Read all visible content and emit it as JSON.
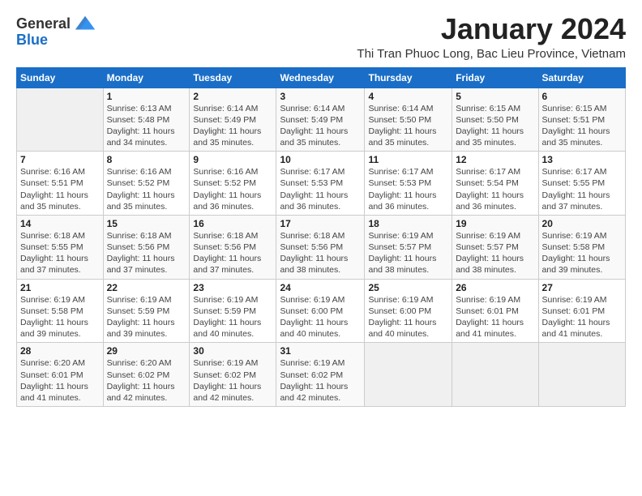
{
  "header": {
    "logo_line1": "General",
    "logo_line2": "Blue",
    "month_title": "January 2024",
    "subtitle": "Thi Tran Phuoc Long, Bac Lieu Province, Vietnam"
  },
  "days_of_week": [
    "Sunday",
    "Monday",
    "Tuesday",
    "Wednesday",
    "Thursday",
    "Friday",
    "Saturday"
  ],
  "weeks": [
    [
      {
        "num": "",
        "sunrise": "",
        "sunset": "",
        "daylight": "",
        "empty": true
      },
      {
        "num": "1",
        "sunrise": "Sunrise: 6:13 AM",
        "sunset": "Sunset: 5:48 PM",
        "daylight": "Daylight: 11 hours and 34 minutes."
      },
      {
        "num": "2",
        "sunrise": "Sunrise: 6:14 AM",
        "sunset": "Sunset: 5:49 PM",
        "daylight": "Daylight: 11 hours and 35 minutes."
      },
      {
        "num": "3",
        "sunrise": "Sunrise: 6:14 AM",
        "sunset": "Sunset: 5:49 PM",
        "daylight": "Daylight: 11 hours and 35 minutes."
      },
      {
        "num": "4",
        "sunrise": "Sunrise: 6:14 AM",
        "sunset": "Sunset: 5:50 PM",
        "daylight": "Daylight: 11 hours and 35 minutes."
      },
      {
        "num": "5",
        "sunrise": "Sunrise: 6:15 AM",
        "sunset": "Sunset: 5:50 PM",
        "daylight": "Daylight: 11 hours and 35 minutes."
      },
      {
        "num": "6",
        "sunrise": "Sunrise: 6:15 AM",
        "sunset": "Sunset: 5:51 PM",
        "daylight": "Daylight: 11 hours and 35 minutes."
      }
    ],
    [
      {
        "num": "7",
        "sunrise": "Sunrise: 6:16 AM",
        "sunset": "Sunset: 5:51 PM",
        "daylight": "Daylight: 11 hours and 35 minutes."
      },
      {
        "num": "8",
        "sunrise": "Sunrise: 6:16 AM",
        "sunset": "Sunset: 5:52 PM",
        "daylight": "Daylight: 11 hours and 35 minutes."
      },
      {
        "num": "9",
        "sunrise": "Sunrise: 6:16 AM",
        "sunset": "Sunset: 5:52 PM",
        "daylight": "Daylight: 11 hours and 36 minutes."
      },
      {
        "num": "10",
        "sunrise": "Sunrise: 6:17 AM",
        "sunset": "Sunset: 5:53 PM",
        "daylight": "Daylight: 11 hours and 36 minutes."
      },
      {
        "num": "11",
        "sunrise": "Sunrise: 6:17 AM",
        "sunset": "Sunset: 5:53 PM",
        "daylight": "Daylight: 11 hours and 36 minutes."
      },
      {
        "num": "12",
        "sunrise": "Sunrise: 6:17 AM",
        "sunset": "Sunset: 5:54 PM",
        "daylight": "Daylight: 11 hours and 36 minutes."
      },
      {
        "num": "13",
        "sunrise": "Sunrise: 6:17 AM",
        "sunset": "Sunset: 5:55 PM",
        "daylight": "Daylight: 11 hours and 37 minutes."
      }
    ],
    [
      {
        "num": "14",
        "sunrise": "Sunrise: 6:18 AM",
        "sunset": "Sunset: 5:55 PM",
        "daylight": "Daylight: 11 hours and 37 minutes."
      },
      {
        "num": "15",
        "sunrise": "Sunrise: 6:18 AM",
        "sunset": "Sunset: 5:56 PM",
        "daylight": "Daylight: 11 hours and 37 minutes."
      },
      {
        "num": "16",
        "sunrise": "Sunrise: 6:18 AM",
        "sunset": "Sunset: 5:56 PM",
        "daylight": "Daylight: 11 hours and 37 minutes."
      },
      {
        "num": "17",
        "sunrise": "Sunrise: 6:18 AM",
        "sunset": "Sunset: 5:56 PM",
        "daylight": "Daylight: 11 hours and 38 minutes."
      },
      {
        "num": "18",
        "sunrise": "Sunrise: 6:19 AM",
        "sunset": "Sunset: 5:57 PM",
        "daylight": "Daylight: 11 hours and 38 minutes."
      },
      {
        "num": "19",
        "sunrise": "Sunrise: 6:19 AM",
        "sunset": "Sunset: 5:57 PM",
        "daylight": "Daylight: 11 hours and 38 minutes."
      },
      {
        "num": "20",
        "sunrise": "Sunrise: 6:19 AM",
        "sunset": "Sunset: 5:58 PM",
        "daylight": "Daylight: 11 hours and 39 minutes."
      }
    ],
    [
      {
        "num": "21",
        "sunrise": "Sunrise: 6:19 AM",
        "sunset": "Sunset: 5:58 PM",
        "daylight": "Daylight: 11 hours and 39 minutes."
      },
      {
        "num": "22",
        "sunrise": "Sunrise: 6:19 AM",
        "sunset": "Sunset: 5:59 PM",
        "daylight": "Daylight: 11 hours and 39 minutes."
      },
      {
        "num": "23",
        "sunrise": "Sunrise: 6:19 AM",
        "sunset": "Sunset: 5:59 PM",
        "daylight": "Daylight: 11 hours and 40 minutes."
      },
      {
        "num": "24",
        "sunrise": "Sunrise: 6:19 AM",
        "sunset": "Sunset: 6:00 PM",
        "daylight": "Daylight: 11 hours and 40 minutes."
      },
      {
        "num": "25",
        "sunrise": "Sunrise: 6:19 AM",
        "sunset": "Sunset: 6:00 PM",
        "daylight": "Daylight: 11 hours and 40 minutes."
      },
      {
        "num": "26",
        "sunrise": "Sunrise: 6:19 AM",
        "sunset": "Sunset: 6:01 PM",
        "daylight": "Daylight: 11 hours and 41 minutes."
      },
      {
        "num": "27",
        "sunrise": "Sunrise: 6:19 AM",
        "sunset": "Sunset: 6:01 PM",
        "daylight": "Daylight: 11 hours and 41 minutes."
      }
    ],
    [
      {
        "num": "28",
        "sunrise": "Sunrise: 6:20 AM",
        "sunset": "Sunset: 6:01 PM",
        "daylight": "Daylight: 11 hours and 41 minutes."
      },
      {
        "num": "29",
        "sunrise": "Sunrise: 6:20 AM",
        "sunset": "Sunset: 6:02 PM",
        "daylight": "Daylight: 11 hours and 42 minutes."
      },
      {
        "num": "30",
        "sunrise": "Sunrise: 6:19 AM",
        "sunset": "Sunset: 6:02 PM",
        "daylight": "Daylight: 11 hours and 42 minutes."
      },
      {
        "num": "31",
        "sunrise": "Sunrise: 6:19 AM",
        "sunset": "Sunset: 6:02 PM",
        "daylight": "Daylight: 11 hours and 42 minutes."
      },
      {
        "num": "",
        "sunrise": "",
        "sunset": "",
        "daylight": "",
        "empty": true
      },
      {
        "num": "",
        "sunrise": "",
        "sunset": "",
        "daylight": "",
        "empty": true
      },
      {
        "num": "",
        "sunrise": "",
        "sunset": "",
        "daylight": "",
        "empty": true
      }
    ]
  ]
}
